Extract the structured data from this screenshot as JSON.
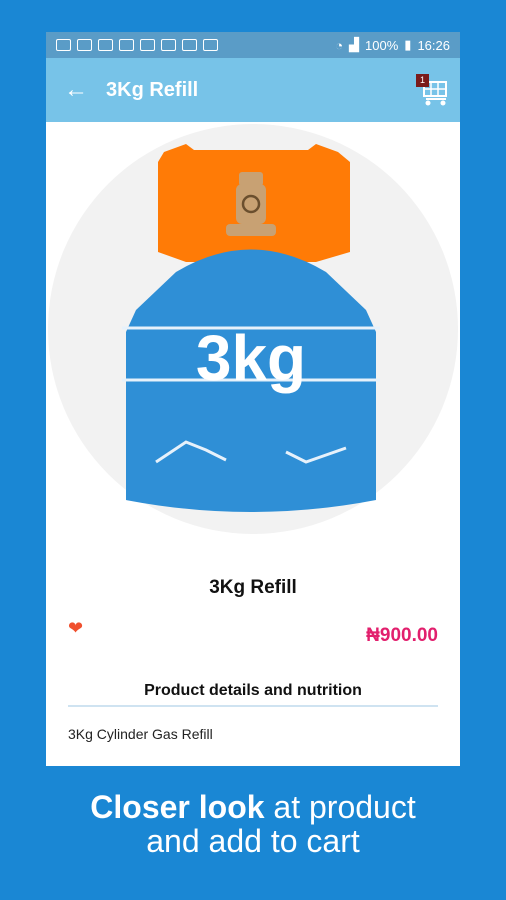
{
  "statusbar": {
    "battery_text": "100%",
    "time": "16:26"
  },
  "appbar": {
    "back_icon": "arrow-left-icon",
    "title": "3Kg Refill",
    "cart_count": "1",
    "cart_icon": "cart-icon"
  },
  "product": {
    "cylinder_label": "3kg",
    "name": "3Kg Refill",
    "price": "₦900.00",
    "heart_icon": "heart-icon",
    "details_heading": "Product details and nutrition",
    "description": "3Kg Cylinder Gas Refill"
  },
  "caption": {
    "line1_bold": "Closer look",
    "line1_rest": " at product",
    "line2": "and add to cart"
  },
  "colors": {
    "background": "#1a87d4",
    "appbar": "#77c3e8",
    "price": "#e21f6d",
    "cylinder_body": "#2f8fd6",
    "cylinder_top": "#ff7b06"
  }
}
